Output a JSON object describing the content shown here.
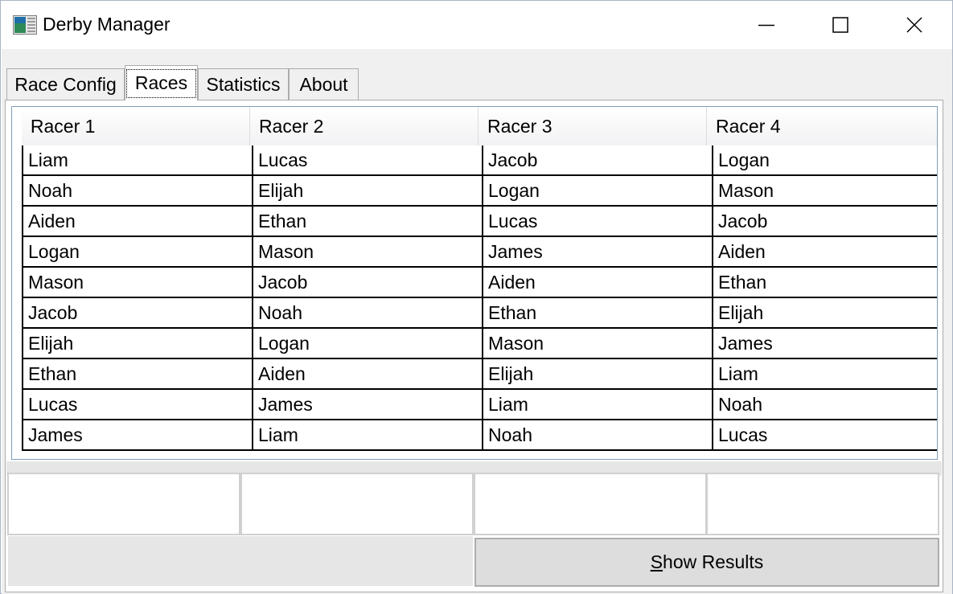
{
  "window": {
    "title": "Derby Manager",
    "icon": "app-icon"
  },
  "tabs": [
    {
      "label": "Race Config",
      "active": false
    },
    {
      "label": "Races",
      "active": true
    },
    {
      "label": "Statistics",
      "active": false
    },
    {
      "label": "About",
      "active": false
    }
  ],
  "grid": {
    "columns": [
      "Racer 1",
      "Racer 2",
      "Racer 3",
      "Racer 4"
    ],
    "rows": [
      [
        "Liam",
        "Lucas",
        "Jacob",
        "Logan"
      ],
      [
        "Noah",
        "Elijah",
        "Logan",
        "Mason"
      ],
      [
        "Aiden",
        "Ethan",
        "Lucas",
        "Jacob"
      ],
      [
        "Logan",
        "Mason",
        "James",
        "Aiden"
      ],
      [
        "Mason",
        "Jacob",
        "Aiden",
        "Ethan"
      ],
      [
        "Jacob",
        "Noah",
        "Ethan",
        "Elijah"
      ],
      [
        "Elijah",
        "Logan",
        "Mason",
        "James"
      ],
      [
        "Ethan",
        "Aiden",
        "Elijah",
        "Liam"
      ],
      [
        "Lucas",
        "James",
        "Liam",
        "Noah"
      ],
      [
        "James",
        "Liam",
        "Noah",
        "Lucas"
      ]
    ]
  },
  "results": [
    "",
    "",
    "",
    ""
  ],
  "buttons": {
    "show_results_mnemonic": "S",
    "show_results_rest": "how Results"
  },
  "colors": {
    "accent_border": "#7f9db9",
    "panel_bg": "#f0f0f0",
    "button_bg": "#dddddd"
  }
}
